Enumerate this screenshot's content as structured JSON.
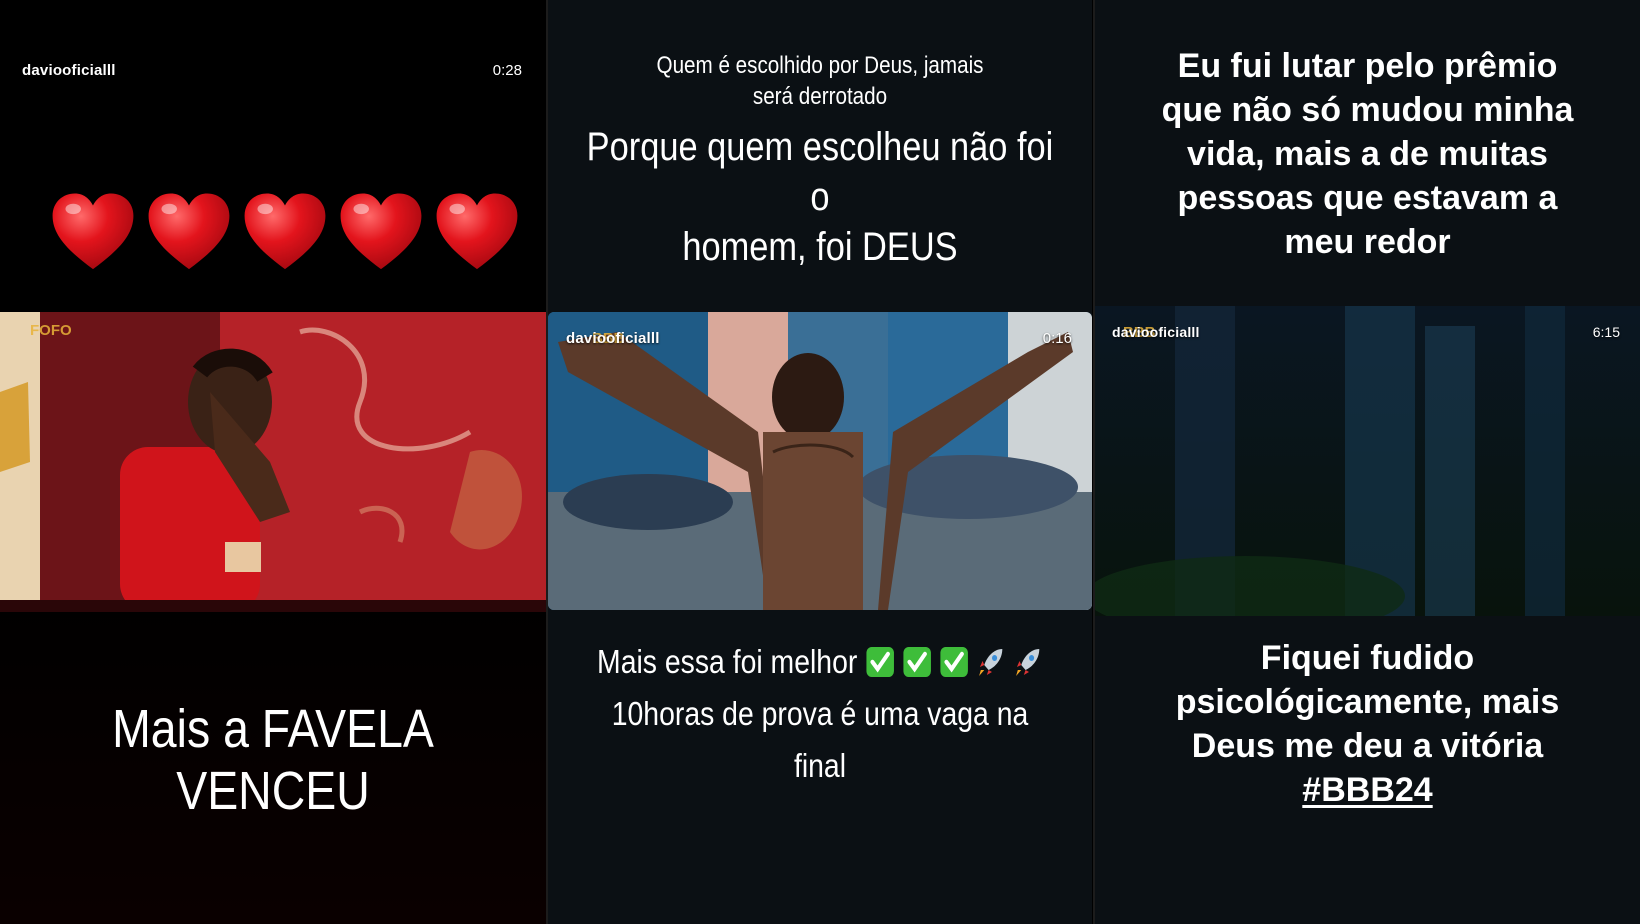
{
  "panel1": {
    "handle": "daviooficialll",
    "duration": "0:28",
    "hearts": [
      "heart",
      "heart",
      "heart",
      "heart",
      "heart"
    ],
    "video_badge": "FOFO",
    "caption": "Mais a FAVELA VENCEU",
    "colors": {
      "heart": "#e3141c",
      "wall_red": "#b52228"
    }
  },
  "panel2": {
    "top_caption": [
      "Quem é escolhido por Deus, jamais",
      "será derrotado"
    ],
    "main_caption": [
      "Porque quem escolheu não foi o",
      "homem, foi DEUS"
    ],
    "handle": "daviooficialll",
    "duration": "0:16",
    "video_badge": "BBB",
    "bottom_caption_line1": "Mais essa foi melhor",
    "bottom_caption_emojis": [
      "check-mark",
      "check-mark",
      "check-mark",
      "rocket",
      "rocket"
    ],
    "bottom_caption_line2": "10horas de prova é uma vaga na final"
  },
  "panel3": {
    "top_caption": [
      "Eu fui lutar pelo prêmio",
      "que não só mudou minha",
      "vida, mais a de muitas",
      "pessoas que estavam a",
      "meu redor"
    ],
    "handle": "daviooficialll",
    "duration": "6:15",
    "video_badge": "BBB",
    "bottom_caption": [
      "Fiquei fudido",
      "psicológicamente, mais",
      "Deus me deu a vitória"
    ],
    "hashtag": "#BBB24"
  }
}
